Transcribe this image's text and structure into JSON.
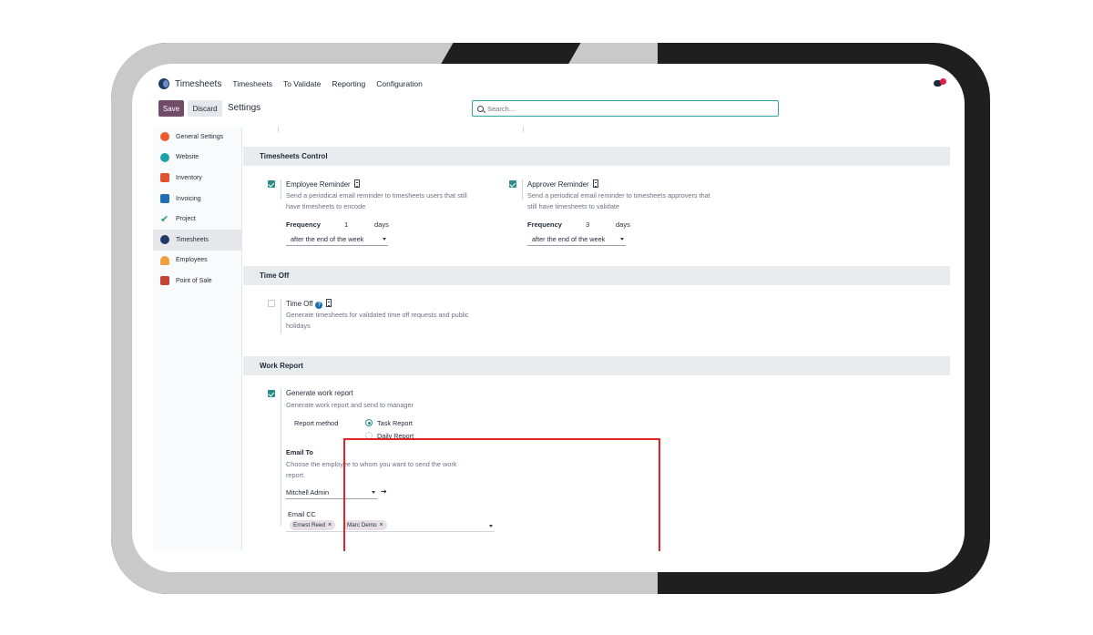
{
  "topbar": {
    "brand": "Timesheets",
    "menu": [
      "Timesheets",
      "To Validate",
      "Reporting",
      "Configuration"
    ]
  },
  "control": {
    "save": "Save",
    "discard": "Discard",
    "title": "Settings",
    "search_placeholder": "Search..."
  },
  "sidebar": {
    "items": [
      {
        "label": "General Settings",
        "color": "#e85d2a"
      },
      {
        "label": "Website",
        "color": "#1ea0a8"
      },
      {
        "label": "Inventory",
        "color": "#e0532f"
      },
      {
        "label": "Invoicing",
        "color": "#1f6fb2"
      },
      {
        "label": "Project",
        "color": "#25a36b"
      },
      {
        "label": "Timesheets",
        "color": "#1f3b63",
        "active": true
      },
      {
        "label": "Employees",
        "color": "#f0a03c"
      },
      {
        "label": "Point of Sale",
        "color": "#c2432f"
      }
    ]
  },
  "sections": {
    "control_title": "Timesheets Control",
    "employee_reminder": {
      "title": "Employee Reminder",
      "desc1": "Send a periodical email reminder to timesheets users that still",
      "desc2": "have timesheets to encode",
      "freq_label": "Frequency",
      "freq_value": "1",
      "days": "days",
      "period": "after the end of the week"
    },
    "approver_reminder": {
      "title": "Approver Reminder",
      "desc1": "Send a periodical email reminder to timesheets approvers that",
      "desc2": "still have timesheets to validate",
      "freq_label": "Frequency",
      "freq_value": "3",
      "days": "days",
      "period": "after the end of the week"
    },
    "time_off_title": "Time Off",
    "time_off": {
      "title": "Time Off",
      "desc1": "Generate timesheets for validated time off requests and public",
      "desc2": "holidays"
    },
    "work_report_title": "Work Report",
    "work_report": {
      "title": "Generate work report",
      "desc": "Generate work report and send to manager",
      "method_label": "Report method",
      "option_task": "Task Report",
      "option_daily": "Daily Report",
      "email_to_label": "Email To",
      "email_to_desc1": "Choose the employee to whom you want to send the work",
      "email_to_desc2": "report.",
      "email_to_value": "Mitchell Admin",
      "email_cc_label": "Email CC",
      "cc_tags": [
        "Ernest Reed",
        "Marc Demo"
      ]
    }
  }
}
